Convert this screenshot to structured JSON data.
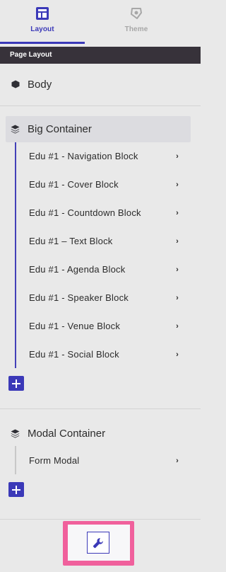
{
  "tabs": [
    {
      "label": "Layout",
      "icon": "layout-icon",
      "active": true
    },
    {
      "label": "Theme",
      "icon": "theme-icon",
      "active": false
    }
  ],
  "section_header": "Page Layout",
  "body_item": {
    "label": "Body",
    "icon": "cube-icon"
  },
  "big_container": {
    "label": "Big Container",
    "icon": "layers-icon",
    "children": [
      "Edu #1 - Navigation Block",
      "Edu #1 - Cover Block",
      "Edu #1 - Countdown Block",
      "Edu #1 – Text Block",
      "Edu #1 - Agenda Block",
      "Edu #1 - Speaker Block",
      "Edu #1 - Venue Block",
      "Edu #1 - Social Block"
    ]
  },
  "modal_container": {
    "label": "Modal Container",
    "icon": "layers-icon",
    "children": [
      "Form Modal"
    ]
  },
  "colors": {
    "accent": "#3b39b8",
    "header_bg": "#37323a",
    "highlight": "#f0609c",
    "background": "#e9e9e9"
  },
  "bottom_tool": {
    "icon": "wrench-icon"
  }
}
